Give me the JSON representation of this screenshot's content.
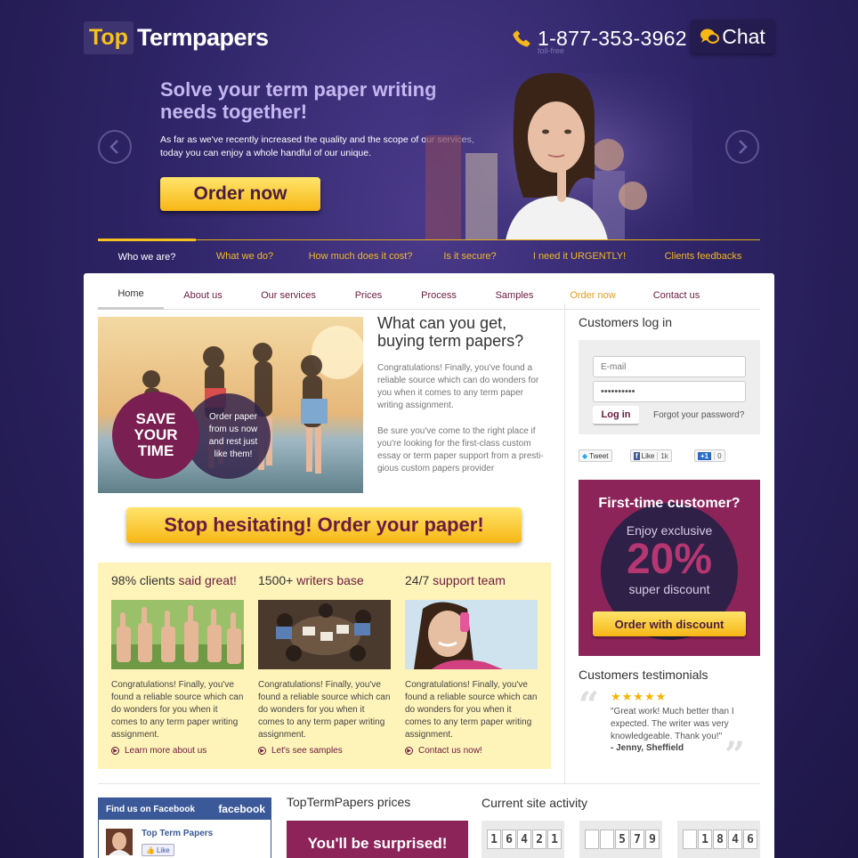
{
  "header": {
    "logo_top": "Top",
    "logo_rest": "Termpapers",
    "phone": "1-877-353-3962",
    "phone_note": "toll-free",
    "chat_label": "Chat"
  },
  "hero": {
    "title": "Solve your term paper writing needs together!",
    "text": "As far as we've recently increased the quality and the scope of our services, today you can enjoy a whole handful of our unique.",
    "cta": "Order now"
  },
  "top_nav": [
    {
      "label": "Who we are?"
    },
    {
      "label": "What we do?"
    },
    {
      "label": "How much does it cost?"
    },
    {
      "label": "Is it secure?"
    },
    {
      "label": "I need it URGENTLY!"
    },
    {
      "label": "Clients feedbacks"
    }
  ],
  "sub_nav": [
    {
      "label": "Home"
    },
    {
      "label": "About us"
    },
    {
      "label": "Our services"
    },
    {
      "label": "Prices"
    },
    {
      "label": "Process"
    },
    {
      "label": "Samples"
    },
    {
      "label": "Order now"
    },
    {
      "label": "Contact us"
    }
  ],
  "intro": {
    "save_line1": "SAVE",
    "save_line2": "YOUR",
    "save_line3": "TIME",
    "order_circle": "Order paper from us now and rest just like them!",
    "title": "What can you get, buying term papers?",
    "p1": "Congratulations! Finally, you've found a reliable source which can do wonders for you when it comes to any term paper writing assignment.",
    "p2": "Be sure you've come to the right place if you're looking for the first-class custom essay or term paper support from a presti- gious custom papers provider"
  },
  "stop_cta": "Stop hesitating! Order your paper!",
  "features": [
    {
      "title_a": "98% clients ",
      "title_b": "said great!",
      "text": "Congratulations! Finally, you've found a reliable source which can do wonders for you when it comes to any term paper writing assignment.",
      "link": "Learn more about us"
    },
    {
      "title_a": "1500+ ",
      "title_b": "writers base",
      "text": "Congratulations! Finally, you've found a reliable source which can do wonders for you when it comes to any term paper writing assignment.",
      "link": "Let's see samples"
    },
    {
      "title_a": "24/7 ",
      "title_b": "support team",
      "text": "Congratulations! Finally, you've found a reliable source which can do wonders for you when it comes to any term paper writing assignment.",
      "link": "Contact us now!"
    }
  ],
  "login": {
    "title": "Customers log in",
    "email_placeholder": "E-mail",
    "password_value": "••••••••••",
    "button": "Log in",
    "forgot": "Forgot your password?"
  },
  "social": {
    "tweet": "Tweet",
    "like": "Like",
    "like_count": "1k",
    "plus": "+1",
    "plus_count": "0"
  },
  "promo": {
    "title": "First-time customer?",
    "enjoy": "Enjoy exclusive",
    "percent": "20%",
    "super": "super discount",
    "button": "Order with discount",
    "bg_color": "#8c245a"
  },
  "testimonials": {
    "title": "Customers testimonials",
    "stars": "★★★★★",
    "rating": 5,
    "text": "\"Great work! Much better than I expected. The writer was very knowledgeable. Thank you!\"",
    "author": "- Jenny, Sheffield"
  },
  "facebook": {
    "head": "Find us on Facebook",
    "logo": "facebook",
    "page_name": "Top Term Papers",
    "like": "Like"
  },
  "prices": {
    "title": "TopTermPapers prices",
    "banner": "You'll be surprised!"
  },
  "activity": {
    "title": "Current site activity",
    "counters": [
      {
        "digits": [
          "1",
          "6",
          "4",
          "2",
          "1"
        ]
      },
      {
        "digits": [
          "",
          "",
          "5",
          "7",
          "9"
        ]
      },
      {
        "digits": [
          "",
          "1",
          "8",
          "4",
          "6"
        ]
      }
    ]
  },
  "colors": {
    "brand_purple": "#2e2466",
    "accent_yellow": "#f7b716",
    "accent_plum": "#6a1b3f"
  }
}
